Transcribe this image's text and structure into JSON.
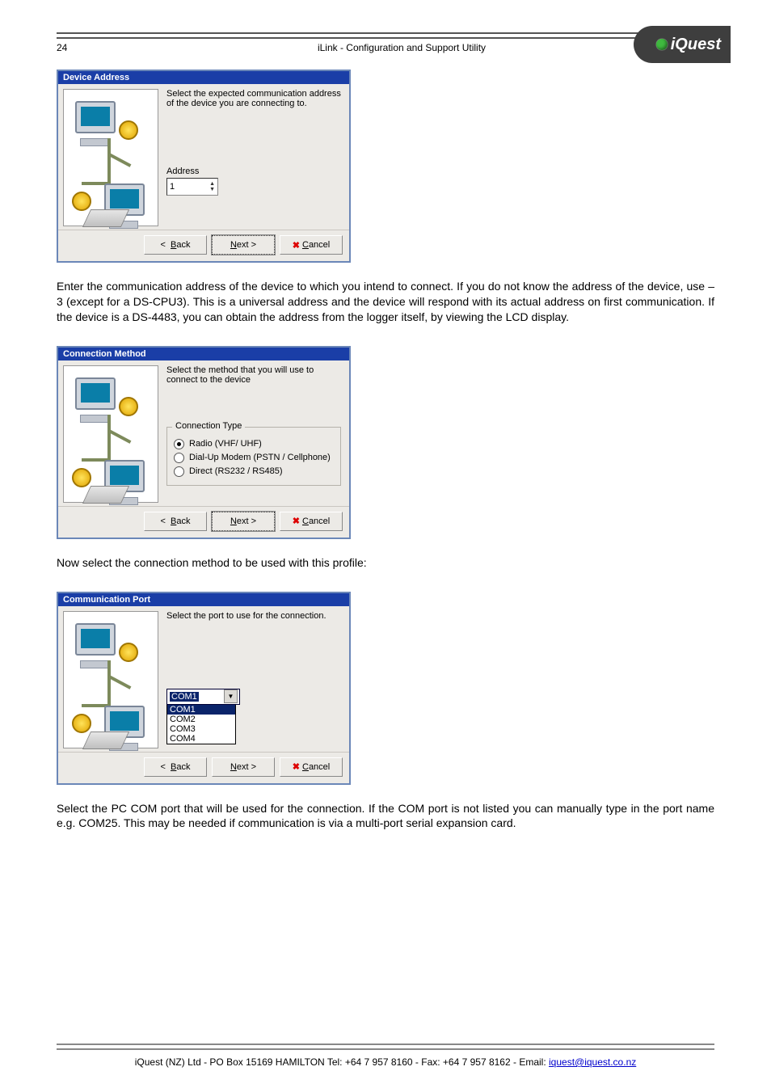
{
  "header": {
    "page_number": "24",
    "title": "iLink - Configuration and Support Utility",
    "logo_text": "iQuest"
  },
  "dialog1": {
    "title": "Device Address",
    "instruction": "Select the expected communication address of the device you are connecting to.",
    "address_label": "Address",
    "address_value": "1",
    "back": "Back",
    "next": "Next >",
    "cancel": "Cancel"
  },
  "para1": "Enter the communication address of the device to which you intend to connect.  If you do not know the address of the device, use –3 (except for a DS-CPU3).  This is a universal address and the device will respond with its actual address on first communication.  If the device is a DS-4483, you can obtain the address from the logger itself, by viewing the LCD display.",
  "dialog2": {
    "title": "Connection Method",
    "instruction": "Select the method that you will use to connect to the device",
    "group_legend": "Connection Type",
    "options": {
      "radio": "Radio  (VHF/ UHF)",
      "dialup": "Dial-Up Modem (PSTN / Cellphone)",
      "direct": "Direct (RS232 / RS485)"
    },
    "back": "Back",
    "next": "Next >",
    "cancel": "Cancel"
  },
  "para2": "Now select the connection method to be used with this profile:",
  "dialog3": {
    "title": "Communication Port",
    "instruction": "Select the port to use for the connection.",
    "selected": "COM1",
    "options": [
      "COM1",
      "COM2",
      "COM3",
      "COM4"
    ],
    "back": "Back",
    "next": "Next >",
    "cancel": "Cancel"
  },
  "para3": "Select the PC COM port that will be used for the connection.  If the COM port is not listed you can manually type in the port name e.g. COM25.  This may be needed if communication is via a multi-port serial expansion card.",
  "footer": {
    "text_prefix": "iQuest (NZ) Ltd  - PO Box 15169 HAMILTON  Tel: +64 7 957 8160 - Fax: +64 7 957 8162 - Email: ",
    "email": "iquest@iquest.co.nz"
  }
}
